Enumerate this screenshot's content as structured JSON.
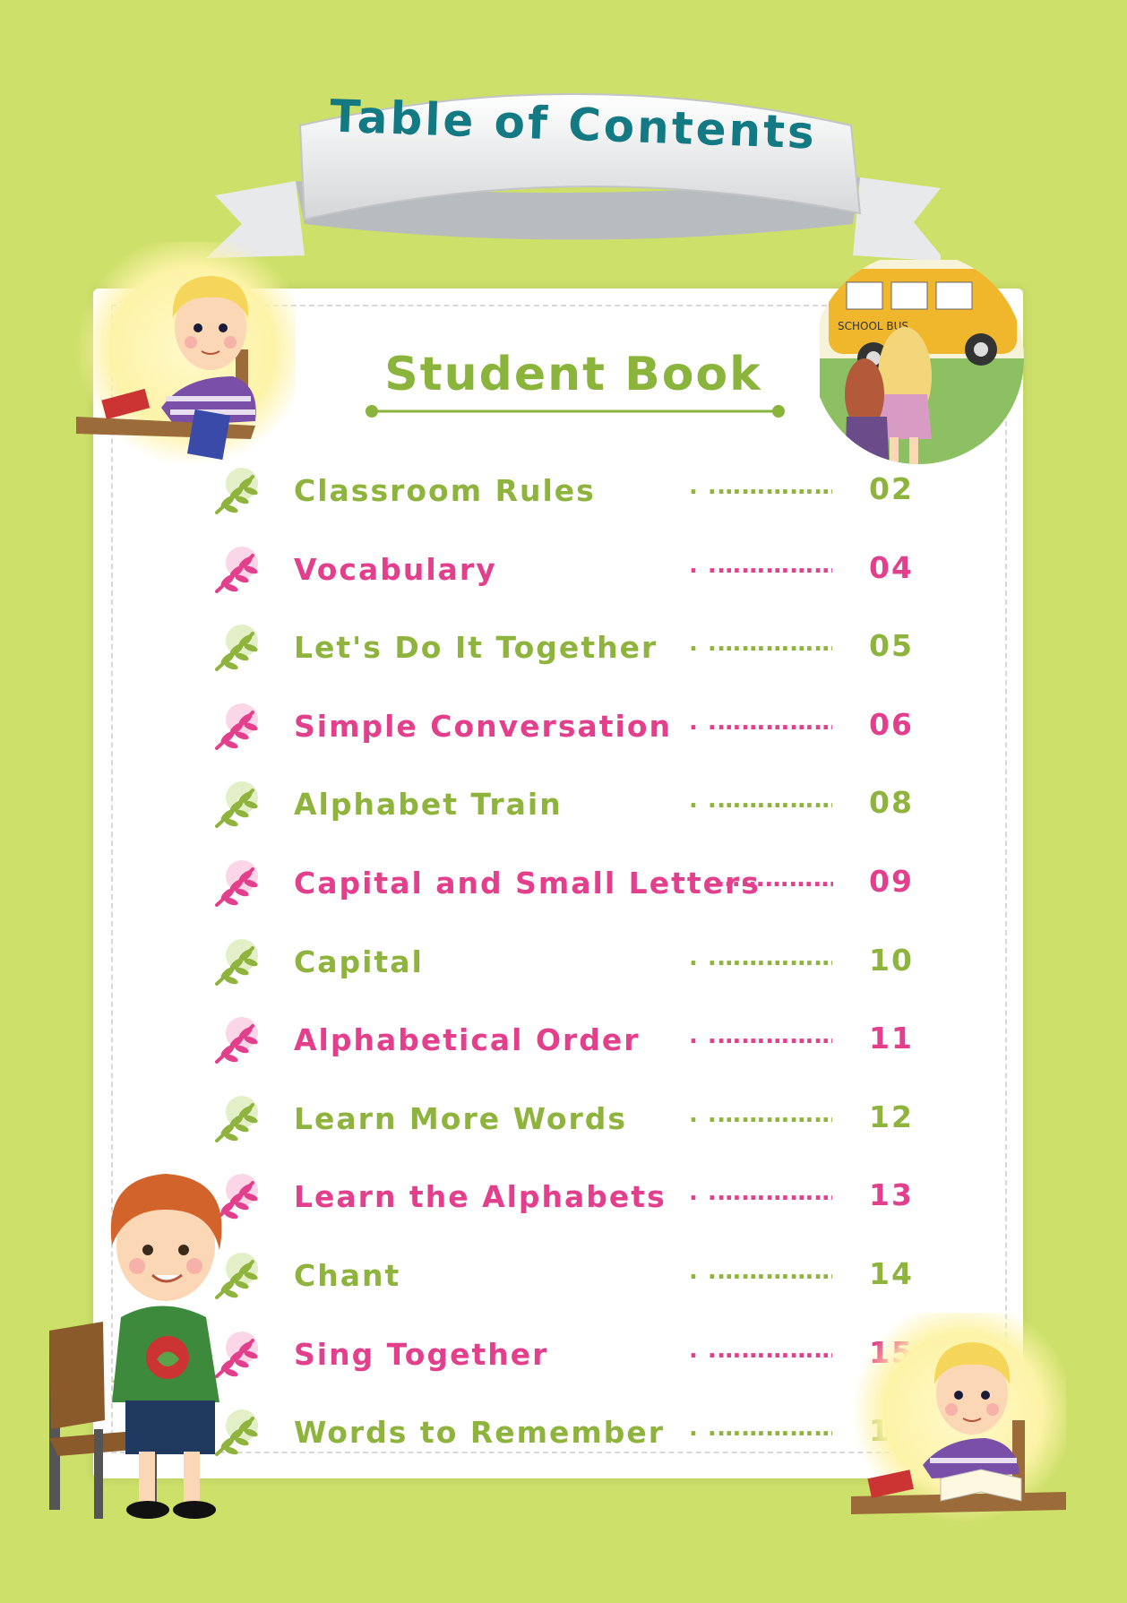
{
  "banner": {
    "title": "Table of Contents"
  },
  "section": {
    "title": "Student Book"
  },
  "bus_sign": "SCHOOL BUS",
  "dots": ". .………………. ",
  "dots_long": "………………. ",
  "toc": [
    {
      "label": "Classroom Rules",
      "page": "02",
      "color": "green"
    },
    {
      "label": "Vocabulary",
      "page": "04",
      "color": "pink"
    },
    {
      "label": "Let's Do It Together",
      "page": "05",
      "color": "green"
    },
    {
      "label": "Simple Conversation",
      "page": "06",
      "color": "pink"
    },
    {
      "label": "Alphabet Train",
      "page": "08",
      "color": "green"
    },
    {
      "label": "Capital and Small Letters",
      "page": "09",
      "color": "pink"
    },
    {
      "label": "Capital",
      "page": "10",
      "color": "green"
    },
    {
      "label": "Alphabetical Order",
      "page": "11",
      "color": "pink"
    },
    {
      "label": "Learn More Words",
      "page": "12",
      "color": "green"
    },
    {
      "label": "Learn the Alphabets",
      "page": "13",
      "color": "pink"
    },
    {
      "label": "Chant",
      "page": "14",
      "color": "green"
    },
    {
      "label": "Sing Together",
      "page": "15",
      "color": "pink"
    },
    {
      "label": "Words to Remember",
      "page": "16",
      "color": "green"
    }
  ],
  "colors": {
    "background": "#cde06a",
    "green_text": "#8fb43e",
    "pink_text": "#e23f8c",
    "banner_text": "#137a83"
  }
}
